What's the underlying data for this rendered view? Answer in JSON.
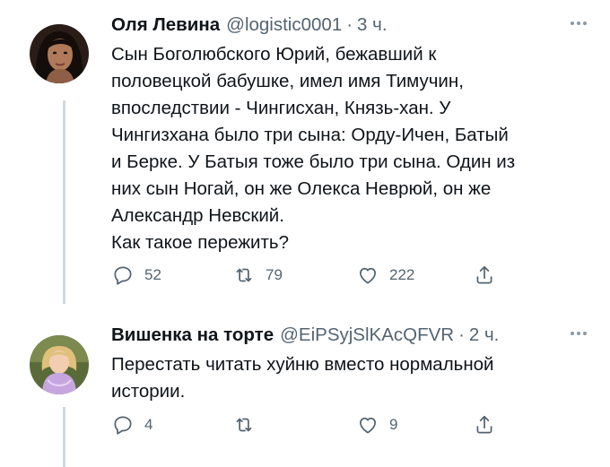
{
  "tweets": [
    {
      "author_name": "Оля Левина",
      "handle": "@logistic0001",
      "separator": "·",
      "time": "3 ч.",
      "text_lines": [
        "Сын Боголюбского Юрий, бежавший к",
        "половецкой бабушке, имел имя Тимучин,",
        "впоследствии - Чингисхан, Князь-хан. У",
        "Чингизхана было три сына: Орду-Ичен, Батый",
        "и Берке. У Батыя тоже было три сына. Один из",
        "них сын Ногай, он же Олекса Неврюй, он же",
        "Александр Невский.",
        "Как такое пережить?"
      ],
      "replies": "52",
      "retweets": "79",
      "likes": "222",
      "icons": [
        "reply-icon",
        "retweet-icon",
        "like-icon",
        "share-icon",
        "more-icon"
      ]
    },
    {
      "author_name": "Вишенка на торте",
      "handle": "@EiPSyjSlKAcQFVR",
      "separator": "·",
      "time": "2 ч.",
      "text_lines": [
        "Перестать читать хуйню вместо нормальной",
        "истории."
      ],
      "replies": "4",
      "retweets": "",
      "likes": "9",
      "icons": [
        "reply-icon",
        "retweet-icon",
        "like-icon",
        "share-icon",
        "more-icon"
      ]
    }
  ],
  "colors": {
    "text": "#0f1419",
    "secondary": "#536471",
    "thread_line": "#cfd9de"
  }
}
